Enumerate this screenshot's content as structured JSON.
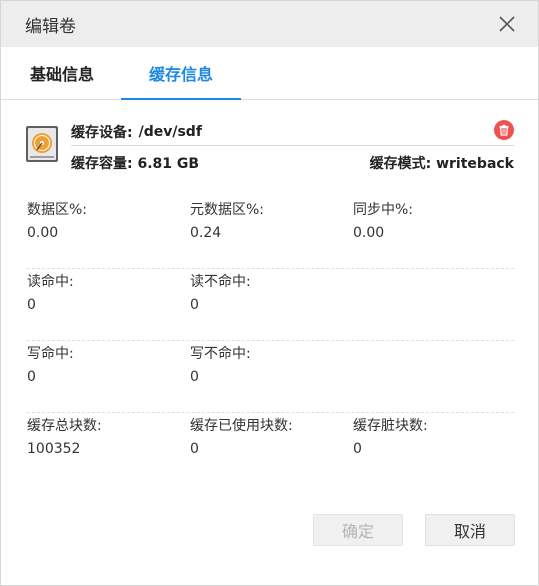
{
  "dialog": {
    "title": "编辑卷"
  },
  "tabs": [
    {
      "label": "基础信息",
      "active": false
    },
    {
      "label": "缓存信息",
      "active": true
    }
  ],
  "cache": {
    "device_label": "缓存设备:",
    "device_value": "/dev/sdf",
    "capacity_label": "缓存容量:",
    "capacity_value": "6.81 GB",
    "mode_label": "缓存模式:",
    "mode_value": "writeback"
  },
  "stats": {
    "data_pct": {
      "label": "数据区%:",
      "value": "0.00"
    },
    "meta_pct": {
      "label": "元数据区%:",
      "value": "0.24"
    },
    "sync_pct": {
      "label": "同步中%:",
      "value": "0.00"
    },
    "read_hit": {
      "label": "读命中:",
      "value": "0"
    },
    "read_miss": {
      "label": "读不命中:",
      "value": "0"
    },
    "write_hit": {
      "label": "写命中:",
      "value": "0"
    },
    "write_miss": {
      "label": "写不命中:",
      "value": "0"
    },
    "total_blocks": {
      "label": "缓存总块数:",
      "value": "100352"
    },
    "used_blocks": {
      "label": "缓存已使用块数:",
      "value": "0"
    },
    "dirty_blocks": {
      "label": "缓存脏块数:",
      "value": "0"
    }
  },
  "buttons": {
    "confirm": "确定",
    "cancel": "取消"
  },
  "colors": {
    "accent": "#1e88e5",
    "delete": "#ef5350",
    "disk_orange": "#f0a030"
  },
  "icons": {
    "close": "close-icon",
    "disk": "hard-disk-icon",
    "delete": "trash-icon"
  }
}
